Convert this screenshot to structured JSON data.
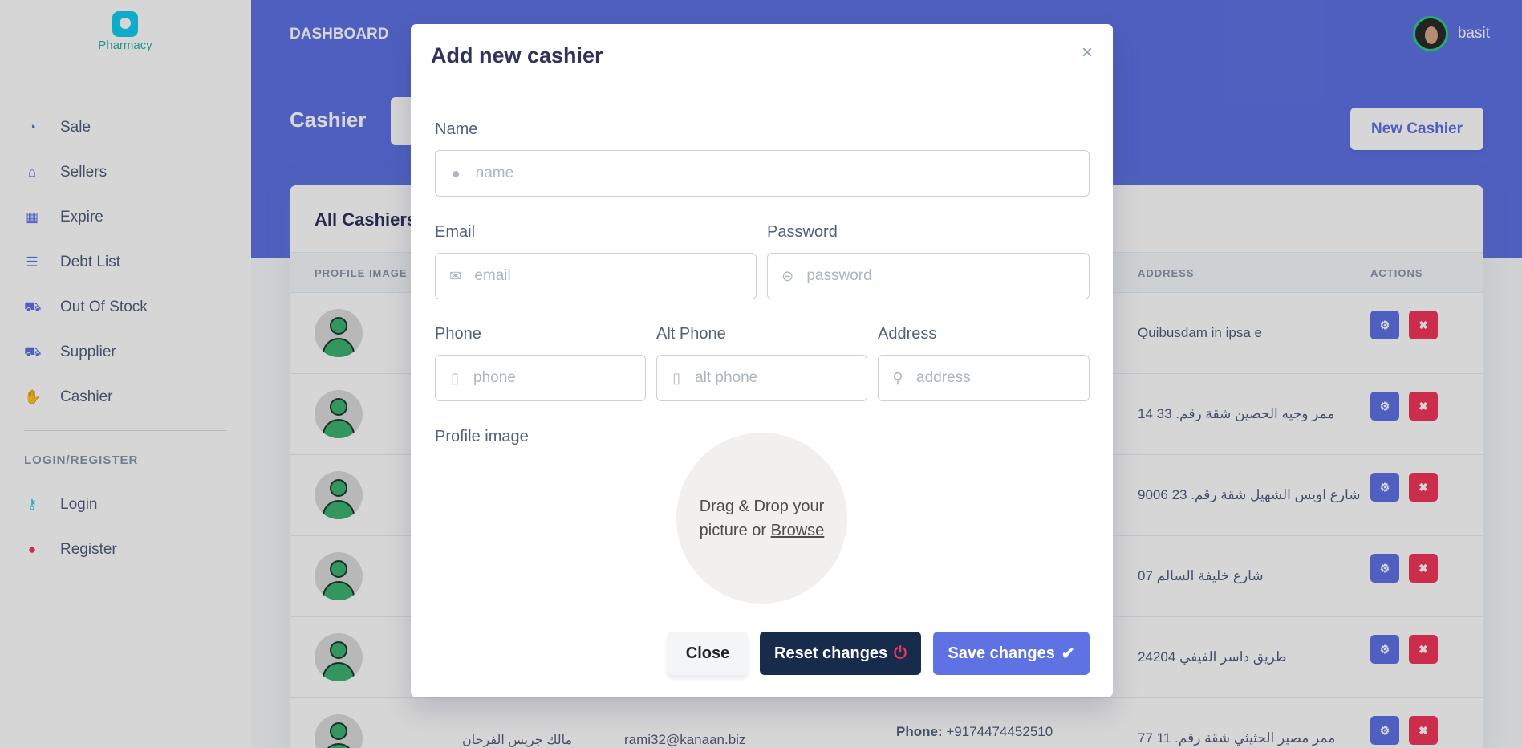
{
  "sidebar": {
    "logo_text": "Pharmacy",
    "items": [
      {
        "label": "Sale",
        "icon": "chart-pie-icon"
      },
      {
        "label": "Sellers",
        "icon": "store-icon"
      },
      {
        "label": "Expire",
        "icon": "calendar-icon"
      },
      {
        "label": "Debt List",
        "icon": "list-icon"
      },
      {
        "label": "Out Of Stock",
        "icon": "cart-icon"
      },
      {
        "label": "Supplier",
        "icon": "truck-icon"
      },
      {
        "label": "Cashier",
        "icon": "hand-coin-icon"
      }
    ],
    "section_heading": "LOGIN/REGISTER",
    "auth_items": [
      {
        "label": "Login",
        "icon": "key-icon"
      },
      {
        "label": "Register",
        "icon": "user-circle-icon"
      }
    ]
  },
  "topbar": {
    "dashboard": "DASHBOARD",
    "username": "basit"
  },
  "header": {
    "title": "Cashier",
    "new_button": "New Cashier"
  },
  "table": {
    "title": "All Cashiers",
    "columns": {
      "profile": "PROFILE IMAGE",
      "address": "ADDRESS",
      "actions": "ACTIONS"
    },
    "rows": [
      {
        "address": "Quibusdam in ipsa e"
      },
      {
        "address": "ممر وجيه الحصين شقة رقم. 33 14"
      },
      {
        "address": "شارع اويس الشهيل شقة رقم. 23 9006"
      },
      {
        "address": "شارع خليفة السالم 07"
      },
      {
        "address": "طريق داسر الفيفي 24204"
      },
      {
        "address": "ممر مصير الحثيثي شقة رقم. 11 77",
        "name": "مالك جريس الفرحان",
        "email": "rami32@kanaan.biz",
        "phone_label": "Phone:",
        "phone": "+9174474452510"
      }
    ]
  },
  "modal": {
    "title": "Add new cashier",
    "close_symbol": "×",
    "name_label": "Name",
    "name_placeholder": "name",
    "email_label": "Email",
    "email_placeholder": "email",
    "password_label": "Password",
    "password_placeholder": "password",
    "phone_label": "Phone",
    "phone_placeholder": "phone",
    "alt_phone_label": "Alt Phone",
    "alt_phone_placeholder": "alt phone",
    "address_label": "Address",
    "address_placeholder": "address",
    "profile_label": "Profile image",
    "drop_text_1": "Drag & Drop your",
    "drop_text_2": "picture or",
    "drop_browse": "Browse",
    "btn_close": "Close",
    "btn_reset": "Reset changes",
    "btn_save": "Save changes"
  },
  "colors": {
    "primary": "#5e72e4",
    "danger": "#f5365c",
    "dark": "#172b4d",
    "success": "#2dce89"
  }
}
